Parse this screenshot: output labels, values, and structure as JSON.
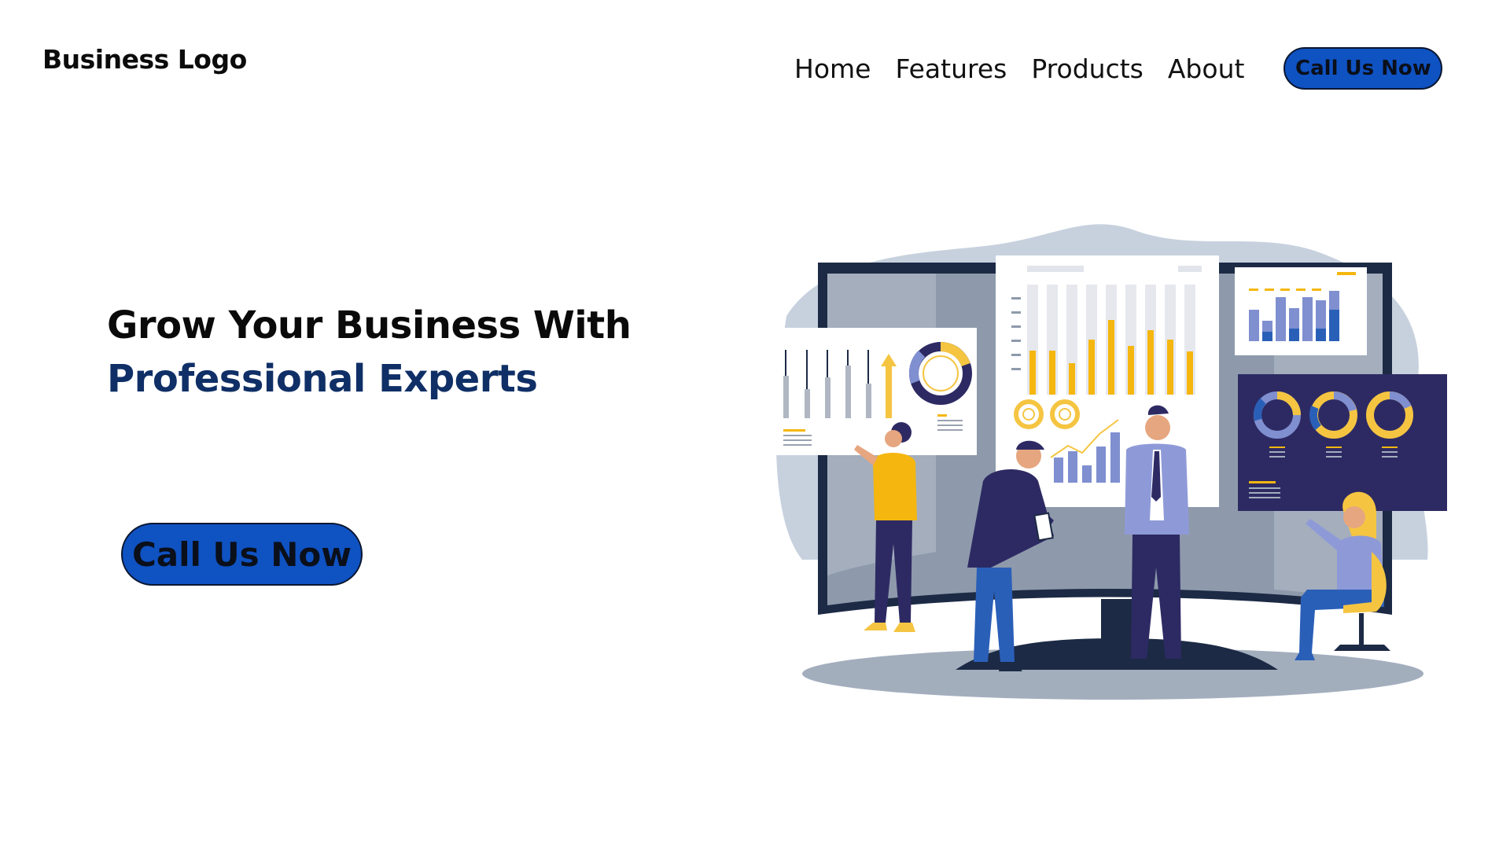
{
  "header": {
    "logo": "Business Logo",
    "nav": [
      {
        "label": "Home"
      },
      {
        "label": "Features"
      },
      {
        "label": "Products"
      },
      {
        "label": "About"
      }
    ],
    "cta_label": "Call Us Now"
  },
  "hero": {
    "title_line1": "Grow Your Business With",
    "title_line2": "Professional Experts",
    "cta_label": "Call Us Now"
  },
  "illustration": {
    "subject": "team-analytics-dashboard",
    "colors": {
      "navy": "#2d2a63",
      "yellow": "#f5b70f",
      "periwinkle": "#7f8fd0",
      "blue_cta": "#0f52c2",
      "screen_frame": "#1c2a45",
      "backdrop": "#c7d1de"
    }
  }
}
